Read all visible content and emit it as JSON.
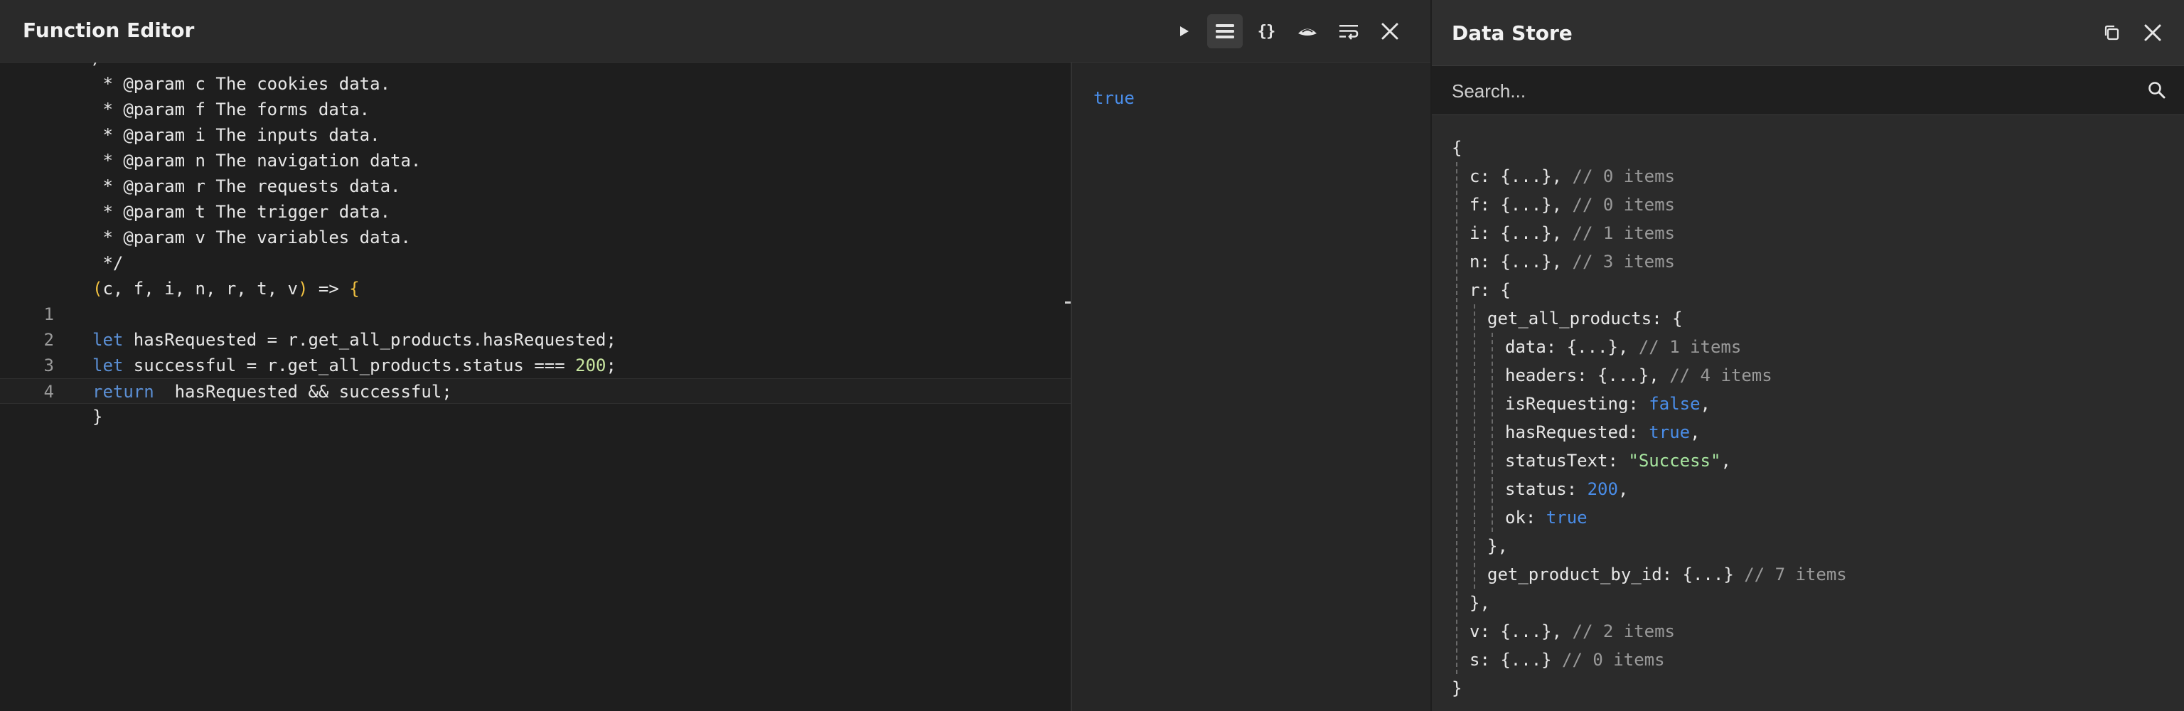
{
  "function_editor": {
    "title": "Function Editor",
    "toolbar": {
      "run": "play-icon",
      "list": "list-icon",
      "braces_label": "{}",
      "theme": "hat-icon",
      "wrap": "wrap-icon",
      "close": "close-icon"
    },
    "code": {
      "header_lines": [
        " * @param c The cookies data.",
        " * @param f The forms data.",
        " * @param i The inputs data.",
        " * @param n The navigation data.",
        " * @param r The requests data.",
        " * @param t The trigger data.",
        " * @param v The variables data.",
        " */"
      ],
      "signature": {
        "open": "(",
        "params": "c, f, i, n, r, t, v",
        "close": ")",
        "arrow": " => ",
        "brace": "{"
      },
      "lines": [
        {
          "num": "1",
          "parts": []
        },
        {
          "num": "2",
          "parts": [
            {
              "k": "let"
            },
            {
              "p": " hasRequested = r.get_all_products.hasRequested;"
            }
          ]
        },
        {
          "num": "3",
          "parts": [
            {
              "k": "let"
            },
            {
              "p": " successful = r.get_all_products.status === "
            },
            {
              "n": "200"
            },
            {
              "p": ";"
            }
          ]
        },
        {
          "num": "4",
          "parts": [
            {
              "k": "return"
            },
            {
              "p": "  hasRequested && successful;"
            }
          ]
        }
      ],
      "closing": "}"
    },
    "result": "true"
  },
  "data_store": {
    "title": "Data Store",
    "toolbar": {
      "copy": "copy-icon",
      "close": "close-icon"
    },
    "search_placeholder": "Search...",
    "tree": [
      {
        "indent": 0,
        "parts": [
          {
            "p": "{"
          }
        ]
      },
      {
        "indent": 1,
        "parts": [
          {
            "p": "c: {...},"
          },
          {
            "c": " // 0 items"
          }
        ]
      },
      {
        "indent": 1,
        "parts": [
          {
            "p": "f: {...},"
          },
          {
            "c": " // 0 items"
          }
        ]
      },
      {
        "indent": 1,
        "parts": [
          {
            "p": "i: {...},"
          },
          {
            "c": " // 1 items"
          }
        ]
      },
      {
        "indent": 1,
        "parts": [
          {
            "p": "n: {...},"
          },
          {
            "c": " // 3 items"
          }
        ]
      },
      {
        "indent": 1,
        "parts": [
          {
            "p": "r: {"
          }
        ]
      },
      {
        "indent": 2,
        "parts": [
          {
            "p": "get_all_products: {"
          }
        ]
      },
      {
        "indent": 3,
        "parts": [
          {
            "p": "data: {...},"
          },
          {
            "c": " // 1 items"
          }
        ]
      },
      {
        "indent": 3,
        "parts": [
          {
            "p": "headers: {...},"
          },
          {
            "c": " // 4 items"
          }
        ]
      },
      {
        "indent": 3,
        "parts": [
          {
            "p": "isRequesting: "
          },
          {
            "b": "false"
          },
          {
            "p": ","
          }
        ]
      },
      {
        "indent": 3,
        "parts": [
          {
            "p": "hasRequested: "
          },
          {
            "b": "true"
          },
          {
            "p": ","
          }
        ]
      },
      {
        "indent": 3,
        "parts": [
          {
            "p": "statusText: "
          },
          {
            "s": "\"Success\""
          },
          {
            "p": ","
          }
        ]
      },
      {
        "indent": 3,
        "parts": [
          {
            "p": "status: "
          },
          {
            "n": "200"
          },
          {
            "p": ","
          }
        ]
      },
      {
        "indent": 3,
        "parts": [
          {
            "p": "ok: "
          },
          {
            "b": "true"
          }
        ]
      },
      {
        "indent": 2,
        "parts": [
          {
            "p": "},"
          }
        ]
      },
      {
        "indent": 2,
        "parts": [
          {
            "p": "get_product_by_id: {...}"
          },
          {
            "c": " // 7 items"
          }
        ]
      },
      {
        "indent": 1,
        "parts": [
          {
            "p": "},"
          }
        ]
      },
      {
        "indent": 1,
        "parts": [
          {
            "p": "v: {...},"
          },
          {
            "c": " // 2 items"
          }
        ]
      },
      {
        "indent": 1,
        "parts": [
          {
            "p": "s: {...}"
          },
          {
            "c": " // 0 items"
          }
        ]
      },
      {
        "indent": 0,
        "parts": [
          {
            "p": "}"
          }
        ]
      }
    ]
  }
}
